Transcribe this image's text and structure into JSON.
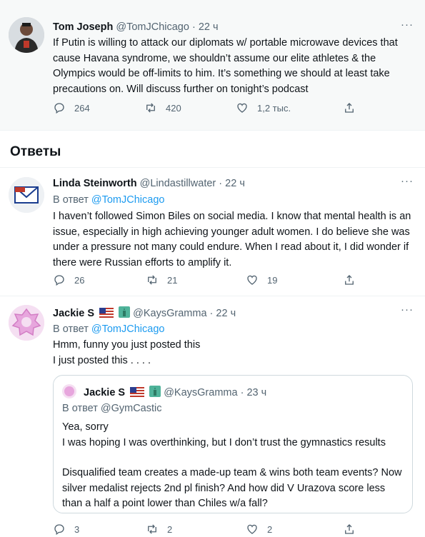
{
  "main_tweet": {
    "name": "Tom Joseph",
    "handle": "@TomJChicago",
    "time": "22 ч",
    "text": "If Putin is willing to attack our diplomats w/ portable microwave devices that cause Havana syndrome, we shouldn’t assume our elite athletes & the Olympics would be off-limits to him. It’s something we should at least take precautions on. Will discuss further on tonight’s podcast",
    "replies": "264",
    "retweets": "420",
    "likes": "1,2 тыс."
  },
  "section_title": "Ответы",
  "replies": [
    {
      "name": "Linda Steinworth",
      "handle": "@Lindastillwater",
      "time": "22 ч",
      "reply_prefix": "В ответ",
      "reply_to": "@TomJChicago",
      "text": "I haven’t followed Simon Biles on social media. I know that mental health is an issue, especially in high achieving younger adult women. I do believe she was under a pressure not many could endure. When I read about it, I did wonder if there were Russian  efforts to amplify it.",
      "replies": "26",
      "retweets": "21",
      "likes": "19",
      "avatar_text_top": "Vote",
      "avatar_text_bottom": "By Mail"
    },
    {
      "name": "Jackie S",
      "handle": "@KaysGramma",
      "time": "22 ч",
      "reply_prefix": "В ответ",
      "reply_to": "@TomJChicago",
      "text_line1": "Hmm, funny you just posted this",
      "text_line2": "I just posted this . . . .",
      "replies": "3",
      "retweets": "2",
      "likes": "2",
      "quote": {
        "name": "Jackie S",
        "handle": "@KaysGramma",
        "time": "23 ч",
        "reply_line": "В ответ @GymCastic",
        "line1": "Yea, sorry",
        "line2": "I was hoping I was overthinking, but I don’t trust the gymnastics results",
        "line3": "Disqualified team creates a made-up team & wins both team events? Now silver medalist rejects 2nd pl finish? And how did V Urazova score less than a half a point lower than Chiles w/a fall?"
      }
    }
  ],
  "separator": "·",
  "more_label": "···",
  "colors": {
    "accent": "#1d9bf0",
    "muted": "#536471",
    "border": "#eff3f4"
  },
  "icons": [
    "reply-icon",
    "retweet-icon",
    "like-icon",
    "share-icon",
    "more-icon"
  ]
}
